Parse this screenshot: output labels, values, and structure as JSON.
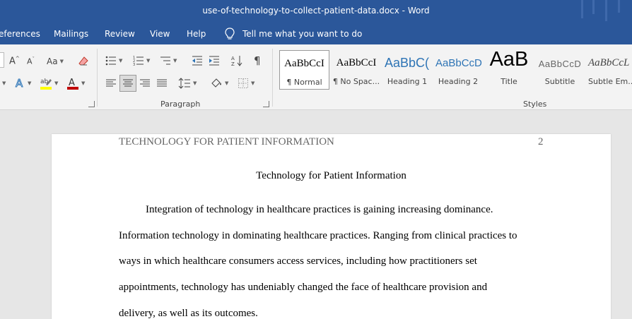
{
  "window": {
    "title": "use-of-technology-to-collect-patient-data.docx  -  Word"
  },
  "menu": {
    "items": [
      "eferences",
      "Mailings",
      "Review",
      "View",
      "Help"
    ],
    "tell_me": "Tell me what you want to do"
  },
  "ribbon": {
    "font_group": {
      "change_case_label": "Aa"
    },
    "paragraph_group": {
      "label": "Paragraph"
    },
    "styles_group": {
      "label": "Styles",
      "items": [
        {
          "sample": "AaBbCcI",
          "name": "¶ Normal",
          "selected": true
        },
        {
          "sample": "AaBbCcI",
          "name": "¶ No Spac..."
        },
        {
          "sample": "AaBbC(",
          "name": "Heading 1"
        },
        {
          "sample": "AaBbCcD",
          "name": "Heading 2"
        },
        {
          "sample": "AaB",
          "name": "Title"
        },
        {
          "sample": "AaBbCcD",
          "name": "Subtitle"
        },
        {
          "sample": "AaBbCcL",
          "name": "Subtle Em..."
        }
      ]
    },
    "colors": {
      "highlight": "#ffff00",
      "font_color": "#c00000",
      "text_effects": "#2e75b6"
    }
  },
  "document": {
    "header_text": "TECHNOLOGY FOR PATIENT INFORMATION",
    "page_number": "2",
    "title": "Technology for Patient Information",
    "lines": [
      "Integration of technology in healthcare practices is gaining increasing dominance.",
      "Information technology in dominating healthcare practices. Ranging from clinical practices to",
      "ways in which healthcare consumers access services, including how practitioners set",
      "appointments, technology has undeniably changed the face of healthcare provision and",
      "delivery, as well as its outcomes."
    ]
  }
}
